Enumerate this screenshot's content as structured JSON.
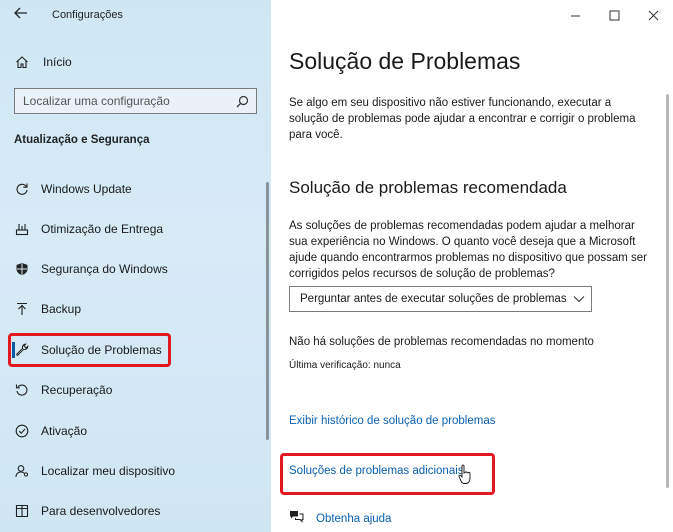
{
  "window": {
    "title": "Configurações"
  },
  "sidebar": {
    "home_label": "Início",
    "search_placeholder": "Localizar uma configuração",
    "section_title": "Atualização e Segurança",
    "items": [
      {
        "label": "Windows Update",
        "icon": "refresh-icon"
      },
      {
        "label": "Otimização de Entrega",
        "icon": "delivery-optimization-icon"
      },
      {
        "label": "Segurança do Windows",
        "icon": "shield-icon"
      },
      {
        "label": "Backup",
        "icon": "backup-arrow-icon"
      },
      {
        "label": "Solução de Problemas",
        "icon": "wrench-icon",
        "selected": true
      },
      {
        "label": "Recuperação",
        "icon": "recovery-icon"
      },
      {
        "label": "Ativação",
        "icon": "check-circle-icon"
      },
      {
        "label": "Localizar meu dispositivo",
        "icon": "person-location-icon"
      },
      {
        "label": "Para desenvolvedores",
        "icon": "developer-tools-icon"
      }
    ]
  },
  "main": {
    "title": "Solução de Problemas",
    "intro": "Se algo em seu dispositivo não estiver funcionando, executar a solução de problemas pode ajudar a encontrar e corrigir o problema para você.",
    "recommended_title": "Solução de problemas recomendada",
    "recommended_desc": "As soluções de problemas recomendadas podem ajudar a melhorar sua experiência no Windows. O quanto você deseja que a Microsoft ajude quando encontrarmos problemas no dispositivo que possam ser corrigidos pelos recursos de solução de problemas?",
    "dropdown_value": "Perguntar antes de executar soluções de problemas",
    "no_recommended": "Não há soluções de problemas recomendadas no momento",
    "last_check": "Última verificação: nunca",
    "history_link": "Exibir histórico de solução de problemas",
    "additional_link": "Soluções de problemas adicionais",
    "help_link": "Obtenha ajuda"
  },
  "colors": {
    "accent": "#0a5fb0",
    "highlight": "#e3171f",
    "sidebar_bg": "#d3e9f5"
  }
}
